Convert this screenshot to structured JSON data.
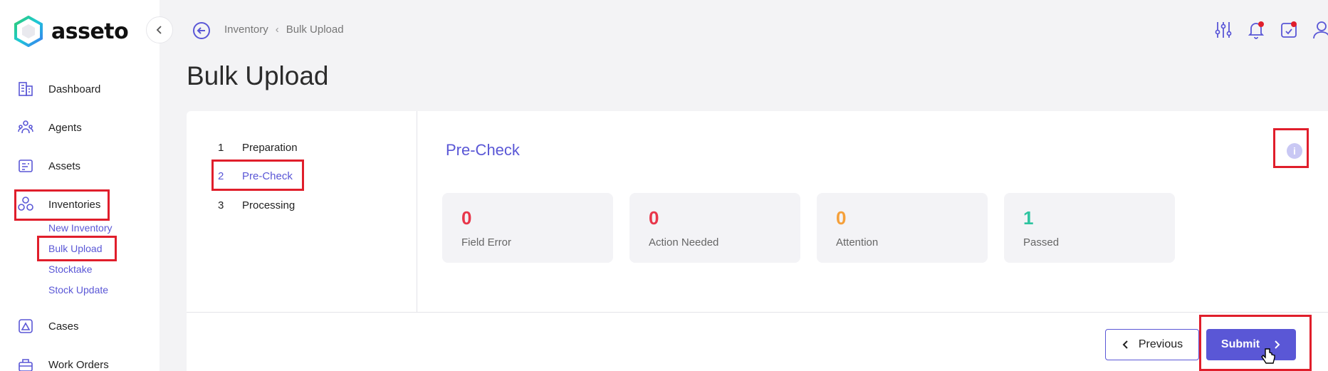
{
  "app": {
    "name": "asseto"
  },
  "sidebar": {
    "items": [
      {
        "label": "Dashboard",
        "icon": "building-icon"
      },
      {
        "label": "Agents",
        "icon": "users-icon"
      },
      {
        "label": "Assets",
        "icon": "assets-icon"
      },
      {
        "label": "Inventories",
        "icon": "inventories-icon"
      },
      {
        "label": "Cases",
        "icon": "case-alert-icon"
      },
      {
        "label": "Work Orders",
        "icon": "toolbox-icon"
      }
    ],
    "inventory_subitems": [
      "New Inventory",
      "Bulk Upload",
      "Stocktake",
      "Stock Update"
    ]
  },
  "header": {
    "breadcrumb": [
      "Inventory",
      "Bulk Upload"
    ],
    "title": "Bulk Upload"
  },
  "steps": [
    {
      "num": "1",
      "label": "Preparation"
    },
    {
      "num": "2",
      "label": "Pre-Check"
    },
    {
      "num": "3",
      "label": "Processing"
    }
  ],
  "panel": {
    "title": "Pre-Check",
    "stats": [
      {
        "count": "0",
        "label": "Field Error",
        "color": "#e8364a"
      },
      {
        "count": "0",
        "label": "Action Needed",
        "color": "#e8364a"
      },
      {
        "count": "0",
        "label": "Attention",
        "color": "#f5a03a"
      },
      {
        "count": "1",
        "label": "Passed",
        "color": "#2ec4a0"
      }
    ]
  },
  "footer": {
    "previous_label": "Previous",
    "submit_label": "Submit"
  },
  "colors": {
    "accent": "#5a57d6",
    "highlight_box": "#e01e2b"
  }
}
